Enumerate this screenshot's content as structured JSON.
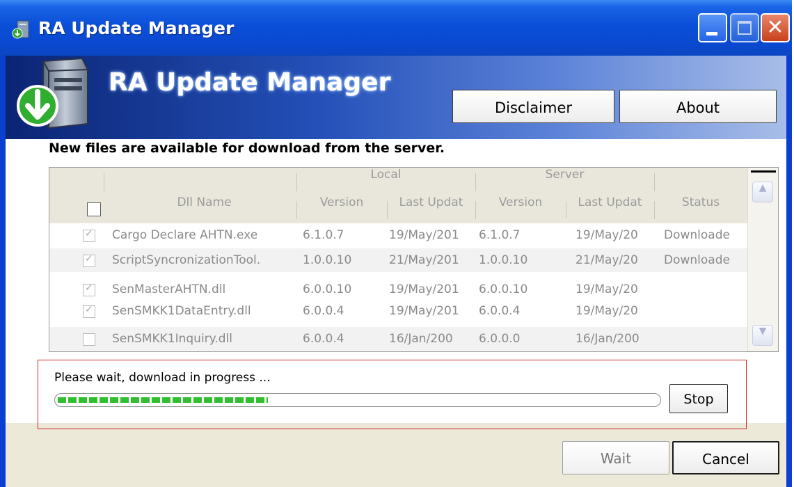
{
  "window": {
    "title": "RA Update Manager"
  },
  "banner": {
    "title": "RA Update Manager",
    "disclaimer_label": "Disclaimer",
    "about_label": "About"
  },
  "heading": "New files are available for download from the server.",
  "grid": {
    "group_headers": [
      "Local",
      "Server"
    ],
    "columns": [
      "Dll Name",
      "Version",
      "Last Updat",
      "Version",
      "Last Updat",
      "Status"
    ],
    "rows": [
      {
        "checked": true,
        "name": "Cargo Declare AHTN.exe",
        "local_version": "6.1.0.7",
        "local_date": "19/May/201",
        "server_version": "6.1.0.7",
        "server_date": "19/May/20",
        "status": "Downloade"
      },
      {
        "checked": true,
        "name": "ScriptSyncronizationTool.",
        "local_version": "1.0.0.10",
        "local_date": "21/May/201",
        "server_version": "1.0.0.10",
        "server_date": "21/May/20",
        "status": "Downloade"
      },
      {
        "checked": true,
        "name": "SenMasterAHTN.dll",
        "local_version": "6.0.0.10",
        "local_date": "19/May/201",
        "server_version": "6.0.0.10",
        "server_date": "19/May/20",
        "status": ""
      },
      {
        "checked": true,
        "name": "SenSMKK1DataEntry.dll",
        "local_version": "6.0.0.4",
        "local_date": "19/May/201",
        "server_version": "6.0.0.4",
        "server_date": "19/May/20",
        "status": ""
      },
      {
        "checked": false,
        "name": "SenSMKK1Inquiry.dll",
        "local_version": "6.0.0.4",
        "local_date": "16/Jan/200",
        "server_version": "6.0.0.0",
        "server_date": "16/Jan/200",
        "status": ""
      }
    ]
  },
  "progress": {
    "message": "Please wait, download in progress ...",
    "fraction": 0.35,
    "stop_label": "Stop"
  },
  "footer": {
    "wait_label": "Wait",
    "cancel_label": "Cancel"
  },
  "colors": {
    "titlebar": "#0b4fd8",
    "highlight_border": "#d22828",
    "progress_fill": "#2fbf2f"
  }
}
